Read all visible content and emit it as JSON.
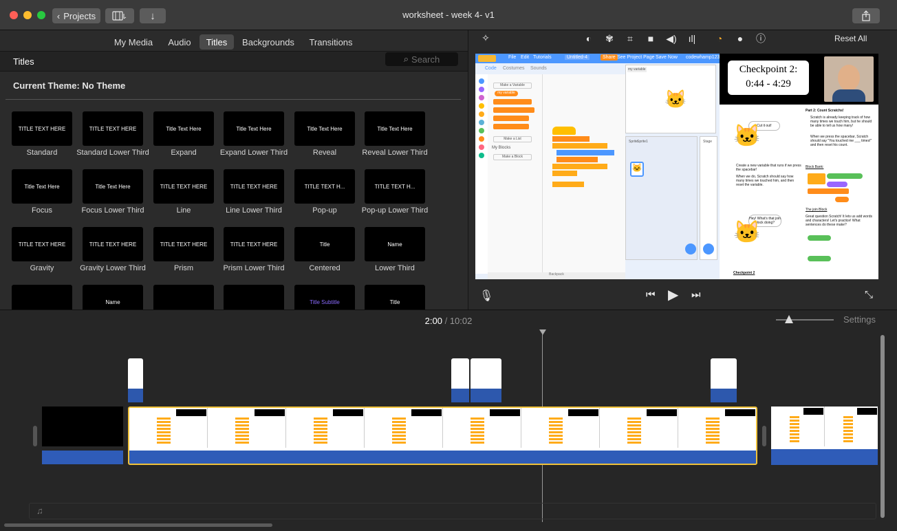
{
  "window": {
    "title": "worksheet - week 4- v1",
    "back_label": "Projects"
  },
  "browser": {
    "tabs": [
      {
        "label": "My Media"
      },
      {
        "label": "Audio"
      },
      {
        "label": "Titles",
        "active": true
      },
      {
        "label": "Backgrounds"
      },
      {
        "label": "Transitions"
      }
    ],
    "section_title": "Titles",
    "search_placeholder": "Search",
    "theme": "Current Theme: No Theme",
    "tiles": [
      {
        "label": "Standard",
        "preview": "TITLE TEXT HERE"
      },
      {
        "label": "Standard Lower Third",
        "preview": "TITLE TEXT HERE"
      },
      {
        "label": "Expand",
        "preview": "Title Text Here"
      },
      {
        "label": "Expand Lower Third",
        "preview": "Title Text Here"
      },
      {
        "label": "Reveal",
        "preview": "Title Text Here"
      },
      {
        "label": "Reveal Lower Third",
        "preview": "Title Text Here"
      },
      {
        "label": "Focus",
        "preview": "Title Text Here"
      },
      {
        "label": "Focus Lower Third",
        "preview": "Title Text Here"
      },
      {
        "label": "Line",
        "preview": "TITLE TEXT HERE"
      },
      {
        "label": "Line Lower Third",
        "preview": "TITLE TEXT HERE"
      },
      {
        "label": "Pop-up",
        "preview": "TITLE TEXT H..."
      },
      {
        "label": "Pop-up Lower Third",
        "preview": "TITLE TEXT H..."
      },
      {
        "label": "Gravity",
        "preview": "TITLE TEXT HERE"
      },
      {
        "label": "Gravity Lower Third",
        "preview": "TITLE TEXT HERE"
      },
      {
        "label": "Prism",
        "preview": "TITLE TEXT HERE"
      },
      {
        "label": "Prism Lower Third",
        "preview": "TITLE TEXT HERE"
      },
      {
        "label": "Centered",
        "preview": "Title"
      },
      {
        "label": "Lower Third",
        "preview": "Name"
      },
      {
        "label": "",
        "preview": ""
      },
      {
        "label": "",
        "preview": "Name"
      },
      {
        "label": "",
        "preview": ""
      },
      {
        "label": "",
        "preview": ""
      },
      {
        "label": "",
        "preview": "Title Subtitle"
      },
      {
        "label": "",
        "preview": "Title"
      }
    ]
  },
  "viewer": {
    "reset_label": "Reset All",
    "checkpoint_line1": "Checkpoint 2:",
    "checkpoint_line2": "0:44 - 4:29",
    "worksheet": {
      "heading": "Part 2: Count Scratchs!",
      "bullet1": "Scratch is already keeping track of how many times we touch him, but he should be able to tell us how many!",
      "bullet2": "When we press the spacebar, Scratch should say \"You touched me ___ times!\" and then reset his count.",
      "step1": "Create a new variable that runs if we press the spacebar!",
      "step2": "When we do, Scratch should say how many times we touched him, and then reset the variable.",
      "block_bank": "Block Bank:",
      "join_block": "The join Block",
      "join_text": "Great question Scratch! It lets us add words and characters! Let's practice! What sentences do these make?",
      "bubble1": "Cut it out!",
      "bubble2": "Hey! What's that join block doing?",
      "footer": "Checkpoint 2"
    },
    "scratch": {
      "menu": [
        "File",
        "Edit",
        "Tutorials"
      ],
      "project_name": "Untitled-4",
      "share": "Share",
      "see_project": "See Project Page",
      "save_now": "Save Now",
      "user": "codewhamp1234",
      "tabs": [
        "Code",
        "Costumes",
        "Sounds"
      ],
      "categories": [
        "Motion",
        "Looks",
        "Sound",
        "Events",
        "Control",
        "Sensing",
        "Operators",
        "Variables",
        "My Blocks",
        "Pen"
      ],
      "make_variable": "Make a Variable",
      "my_variable": "my variable",
      "make_list": "Make a List",
      "my_blocks": "My Blocks",
      "make_block": "Make a Block",
      "sprite_label": "Sprite",
      "sprite_name": "Sprite1",
      "stage_label": "Stage",
      "backpack": "Backpack"
    }
  },
  "timeline": {
    "current_time": "2:00",
    "total_time": "10:02",
    "settings_label": "Settings"
  },
  "colors": {
    "accent": "#f5c13b",
    "clip_border": "#f0c23a",
    "audio": "#2f5cb8",
    "traffic_red": "#fe5f57",
    "traffic_yellow": "#febc2e",
    "traffic_green": "#28c840"
  },
  "icons": [
    "back-chevron-icon",
    "library-icon",
    "import-icon",
    "share-icon",
    "magic-wand-icon",
    "color-balance-icon",
    "color-palette-icon",
    "crop-icon",
    "stabilization-icon",
    "volume-icon",
    "equalizer-icon",
    "speed-icon",
    "filter-icon",
    "info-icon",
    "microphone-icon",
    "skip-back-icon",
    "play-icon",
    "skip-forward-icon",
    "fullscreen-icon",
    "music-note-icon"
  ]
}
